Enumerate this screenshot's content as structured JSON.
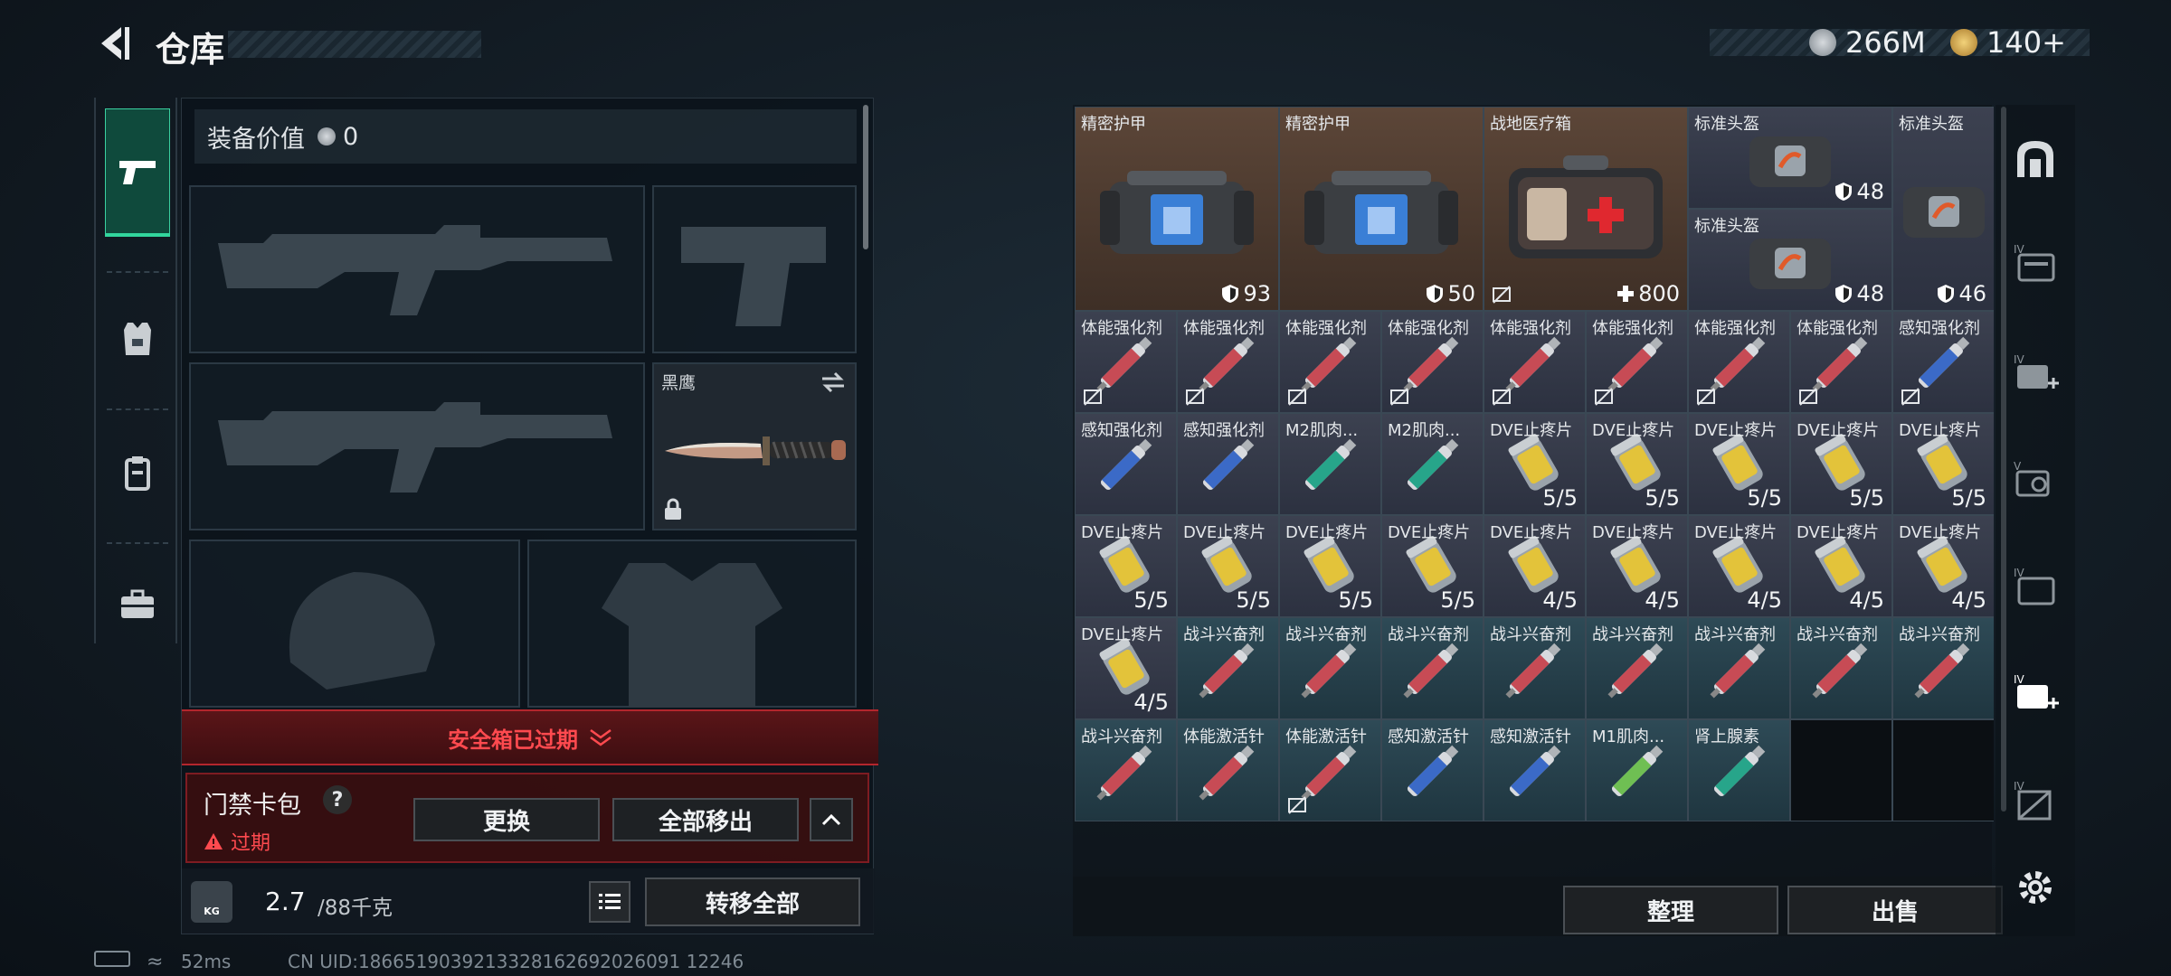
{
  "header": {
    "title": "仓库",
    "currency1": "266M",
    "currency2": "140+"
  },
  "equip_value": {
    "label": "装备价值",
    "value": "0"
  },
  "knife": {
    "name": "黑鹰"
  },
  "safe_box": {
    "status": "安全箱已过期"
  },
  "key_case": {
    "name": "门禁卡包",
    "help": "?",
    "expired": "过期",
    "replace_label": "更换",
    "move_all_out_label": "全部移出"
  },
  "weight": {
    "current": "2.7",
    "max": "/88千克",
    "kg_badge": "KG"
  },
  "transfer_all_label": "转移全部",
  "sort_label": "整理",
  "sell_label": "出售",
  "status_bar": {
    "ping": "52ms",
    "uid": "CN UID:1866519039213328162692026091 12246"
  },
  "grid_items": [
    {
      "name": "精密护甲",
      "qty": "93",
      "icon": "shield"
    },
    {
      "name": "精密护甲",
      "qty": "50",
      "icon": "shield"
    },
    {
      "name": "战地医疗箱",
      "qty": "800",
      "icon": "plus"
    },
    {
      "name": "标准头盔",
      "qty": "48",
      "icon": "shield"
    },
    {
      "name": "标准头盔",
      "qty": "48",
      "icon": "shield"
    },
    {
      "name": "标准头盔",
      "qty": "46",
      "icon": "shield"
    },
    {
      "name": "体能强化剂"
    },
    {
      "name": "体能强化剂"
    },
    {
      "name": "体能强化剂"
    },
    {
      "name": "体能强化剂"
    },
    {
      "name": "体能强化剂"
    },
    {
      "name": "体能强化剂"
    },
    {
      "name": "体能强化剂"
    },
    {
      "name": "体能强化剂"
    },
    {
      "name": "感知强化剂"
    },
    {
      "name": "感知强化剂"
    },
    {
      "name": "感知强化剂"
    },
    {
      "name": "M2肌肉..."
    },
    {
      "name": "M2肌肉..."
    },
    {
      "name": "DVE止疼片",
      "qty": "5/5"
    },
    {
      "name": "DVE止疼片",
      "qty": "5/5"
    },
    {
      "name": "DVE止疼片",
      "qty": "5/5"
    },
    {
      "name": "DVE止疼片",
      "qty": "5/5"
    },
    {
      "name": "DVE止疼片",
      "qty": "5/5"
    },
    {
      "name": "DVE止疼片",
      "qty": "5/5"
    },
    {
      "name": "DVE止疼片",
      "qty": "5/5"
    },
    {
      "name": "DVE止疼片",
      "qty": "5/5"
    },
    {
      "name": "DVE止疼片",
      "qty": "5/5"
    },
    {
      "name": "DVE止疼片",
      "qty": "4/5"
    },
    {
      "name": "DVE止疼片",
      "qty": "4/5"
    },
    {
      "name": "DVE止疼片",
      "qty": "4/5"
    },
    {
      "name": "DVE止疼片",
      "qty": "4/5"
    },
    {
      "name": "DVE止疼片",
      "qty": "4/5"
    },
    {
      "name": "DVE止疼片",
      "qty": "4/5"
    },
    {
      "name": "战斗兴奋剂"
    },
    {
      "name": "战斗兴奋剂"
    },
    {
      "name": "战斗兴奋剂"
    },
    {
      "name": "战斗兴奋剂"
    },
    {
      "name": "战斗兴奋剂"
    },
    {
      "name": "战斗兴奋剂"
    },
    {
      "name": "战斗兴奋剂"
    },
    {
      "name": "战斗兴奋剂"
    },
    {
      "name": "战斗兴奋剂"
    },
    {
      "name": "体能激活针"
    },
    {
      "name": "体能激活针"
    },
    {
      "name": "感知激活针"
    },
    {
      "name": "感知激活针"
    },
    {
      "name": "M1肌肉..."
    },
    {
      "name": "肾上腺素"
    }
  ],
  "colors": {
    "accent_green": "#31d69d",
    "danger_red": "#ff4a4f",
    "blue_cell": "#3c4150",
    "brown_cell": "#5c4638",
    "green_cell": "#2e4a56"
  }
}
